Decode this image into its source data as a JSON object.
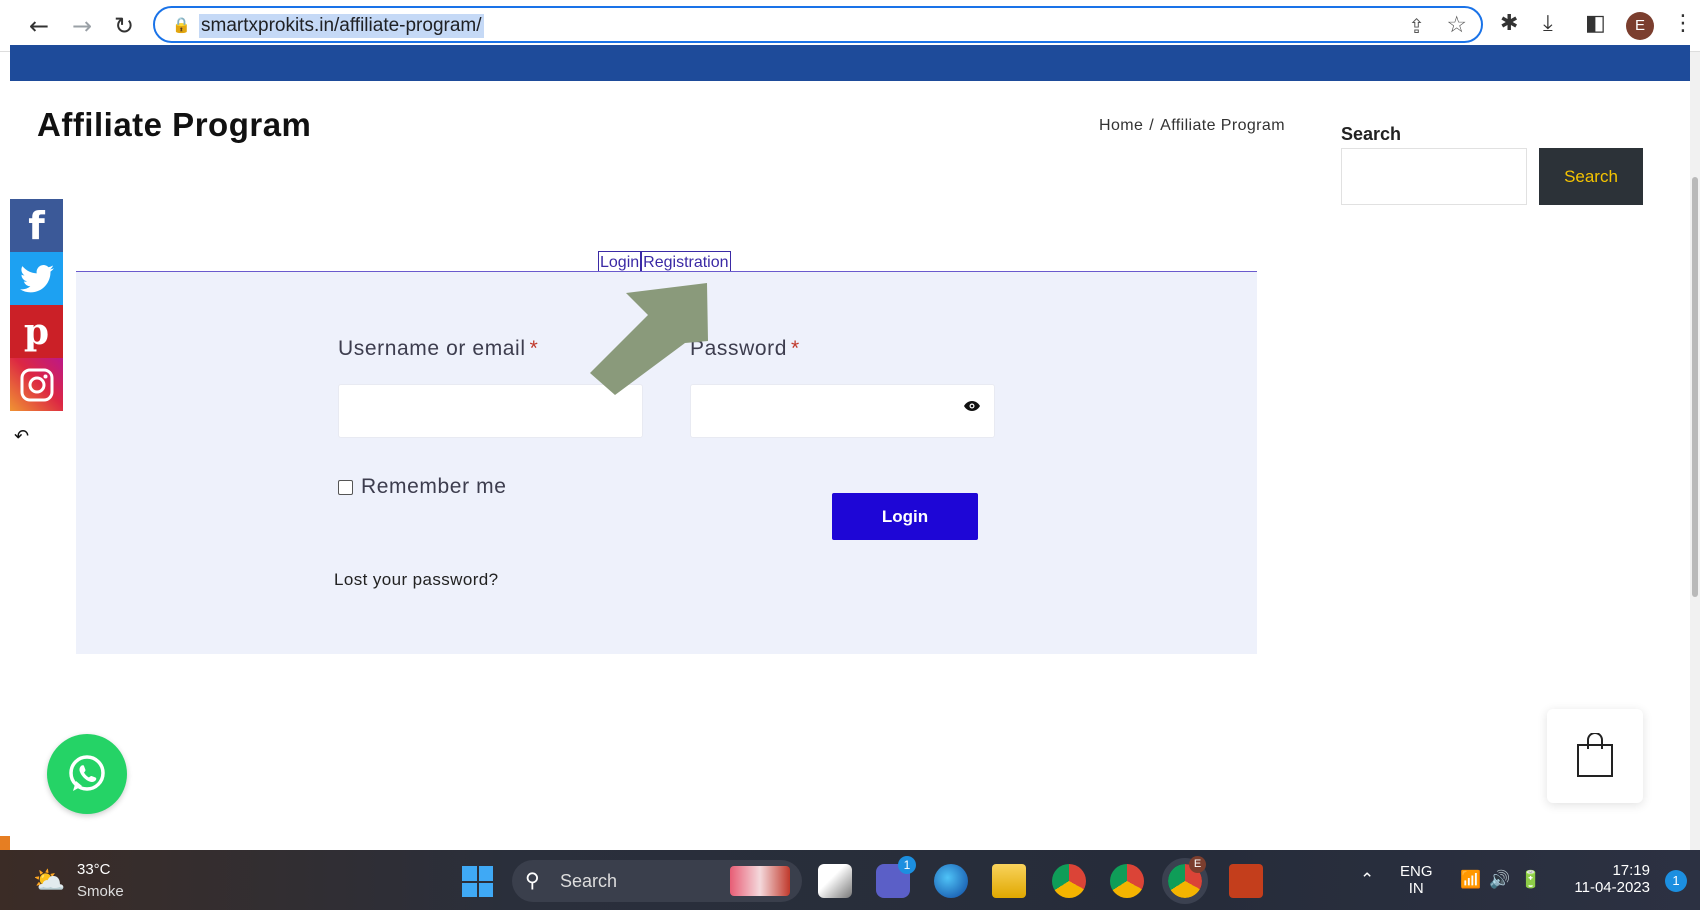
{
  "browser": {
    "url": "smartxprokits.in/affiliate-program/",
    "profile_initial": "E"
  },
  "page": {
    "title": "Affiliate Program",
    "breadcrumb": {
      "home": "Home",
      "separator": "/",
      "current": "Affiliate Program"
    }
  },
  "sidebar": {
    "search_label": "Search",
    "search_button": "Search",
    "search_value": ""
  },
  "form": {
    "tabs": [
      "Login",
      "Registration"
    ],
    "username_label": "Username or email",
    "password_label": "Password",
    "required_mark": "*",
    "username_value": "",
    "password_value": "",
    "remember_label": "Remember me",
    "remember_checked": false,
    "login_button": "Login",
    "lost_password": "Lost your password?"
  },
  "social": [
    "facebook-icon",
    "twitter-icon",
    "pinterest-icon",
    "instagram-icon"
  ],
  "taskbar": {
    "weather_temp": "33°C",
    "weather_desc": "Smoke",
    "search_label": "Search",
    "teams_badge": "1",
    "chrome_badge": "E",
    "lang_top": "ENG",
    "lang_bottom": "IN",
    "time": "17:19",
    "date": "11-04-2023",
    "notification_count": "1"
  },
  "colors": {
    "header_blue": "#1e4b9a",
    "login_button": "#1e06d6",
    "search_button_bg": "#2c3238",
    "search_button_text": "#f5c400",
    "form_panel": "#eef1fb",
    "annotation_arrow": "#8a9a7b"
  }
}
